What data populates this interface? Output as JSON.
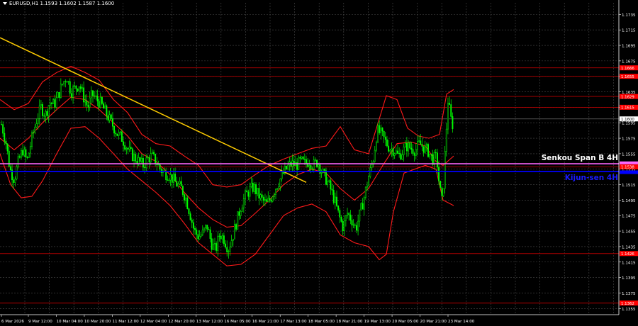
{
  "header": {
    "title": "EURUSD,H1  1.1593 1.1602 1.1587 1.1600"
  },
  "colors": {
    "background": "#000000",
    "grid": "#4a4a4a",
    "candle_up": "#00ff00",
    "candle_down": "#00ff00",
    "bands": "#ff1a1a",
    "level": "#b40000",
    "trendline": "#ffcc00",
    "senkou": "#ff66ff",
    "kijun": "#0000ff",
    "price_line": "#808080"
  },
  "chart_data": {
    "type": "candlestick",
    "symbol": "EURUSD",
    "timeframe": "H1",
    "ylim": [
      1.1347,
      1.175
    ],
    "grid": true,
    "y_ticks": [
      "1.1735",
      "1.1715",
      "1.1695",
      "1.1675",
      "1.1655",
      "1.1635",
      "1.1615",
      "1.1595",
      "1.1575",
      "1.1555",
      "1.1535",
      "1.1515",
      "1.1495",
      "1.1475",
      "1.1455",
      "1.1435",
      "1.1415",
      "1.1395",
      "1.1375",
      "1.1355"
    ],
    "x_ticks": [
      "6 Mar 2026",
      "9 Mar 12:00",
      "10 Mar 04:00",
      "10 Mar 20:00",
      "11 Mar 12:00",
      "12 Mar 04:00",
      "12 Mar 20:00",
      "13 Mar 12:00",
      "16 Mar 05:00",
      "16 Mar 21:00",
      "17 Mar 13:00",
      "18 Mar 05:00",
      "18 Mar 21:00",
      "19 Mar 13:00",
      "20 Mar 05:00",
      "20 Mar 21:00",
      "23 Mar 14:00"
    ],
    "levels": [
      {
        "label": "1.1666",
        "value": 1.1666
      },
      {
        "label": "1.1655",
        "value": 1.1655
      },
      {
        "label": "1.1629",
        "value": 1.1629
      },
      {
        "label": "1.1615",
        "value": 1.1615
      },
      {
        "label": "1.1538",
        "value": 1.1538
      },
      {
        "label": "1.1426",
        "value": 1.1426
      },
      {
        "label": "1.1362",
        "value": 1.1362
      }
    ],
    "indicator_lines": [
      {
        "name": "Senkou Span B 4H",
        "value": 1.1542,
        "label": "Senkou Span B 4H"
      },
      {
        "name": "Kijun-sen 4H",
        "value": 1.1532,
        "label": "Kijun-sen 4H"
      }
    ],
    "current_price": {
      "label": "1.1600",
      "value": 1.16
    },
    "trendline": {
      "from": {
        "x": 0,
        "y": 1.1705
      },
      "to": {
        "x": 432,
        "y": 1.1518
      }
    },
    "close_path": [
      [
        0,
        1.16
      ],
      [
        8,
        1.1572
      ],
      [
        14,
        1.1535
      ],
      [
        20,
        1.1522
      ],
      [
        26,
        1.1545
      ],
      [
        32,
        1.156
      ],
      [
        38,
        1.1545
      ],
      [
        45,
        1.1575
      ],
      [
        52,
        1.16
      ],
      [
        58,
        1.1615
      ],
      [
        64,
        1.1605
      ],
      [
        70,
        1.1622
      ],
      [
        76,
        1.1618
      ],
      [
        82,
        1.163
      ],
      [
        88,
        1.1645
      ],
      [
        94,
        1.1655
      ],
      [
        100,
        1.1635
      ],
      [
        106,
        1.164
      ],
      [
        112,
        1.1645
      ],
      [
        118,
        1.1628
      ],
      [
        124,
        1.1615
      ],
      [
        130,
        1.1632
      ],
      [
        136,
        1.1625
      ],
      [
        142,
        1.162
      ],
      [
        148,
        1.161
      ],
      [
        154,
        1.16
      ],
      [
        160,
        1.159
      ],
      [
        166,
        1.158
      ],
      [
        172,
        1.1575
      ],
      [
        178,
        1.1565
      ],
      [
        184,
        1.1555
      ],
      [
        190,
        1.155
      ],
      [
        196,
        1.1545
      ],
      [
        202,
        1.154
      ],
      [
        208,
        1.1548
      ],
      [
        214,
        1.1552
      ],
      [
        220,
        1.1545
      ],
      [
        226,
        1.1535
      ],
      [
        232,
        1.153
      ],
      [
        238,
        1.1528
      ],
      [
        244,
        1.1522
      ],
      [
        250,
        1.1515
      ],
      [
        256,
        1.151
      ],
      [
        262,
        1.1498
      ],
      [
        268,
        1.1478
      ],
      [
        274,
        1.1455
      ],
      [
        280,
        1.1448
      ],
      [
        286,
        1.1452
      ],
      [
        292,
        1.1462
      ],
      [
        298,
        1.144
      ],
      [
        304,
        1.143
      ],
      [
        310,
        1.1452
      ],
      [
        316,
        1.1445
      ],
      [
        322,
        1.1432
      ],
      [
        328,
        1.1448
      ],
      [
        334,
        1.1468
      ],
      [
        340,
        1.1488
      ],
      [
        346,
        1.15
      ],
      [
        352,
        1.1508
      ],
      [
        358,
        1.1512
      ],
      [
        364,
        1.1502
      ],
      [
        370,
        1.1495
      ],
      [
        376,
        1.149
      ],
      [
        382,
        1.1498
      ],
      [
        388,
        1.151
      ],
      [
        394,
        1.152
      ],
      [
        400,
        1.153
      ],
      [
        406,
        1.1538
      ],
      [
        412,
        1.1542
      ],
      [
        418,
        1.154
      ],
      [
        424,
        1.1545
      ],
      [
        430,
        1.1542
      ],
      [
        436,
        1.1546
      ],
      [
        442,
        1.154
      ],
      [
        448,
        1.1545
      ],
      [
        454,
        1.1532
      ],
      [
        460,
        1.1522
      ],
      [
        466,
        1.151
      ],
      [
        472,
        1.1495
      ],
      [
        478,
        1.1475
      ],
      [
        484,
        1.146
      ],
      [
        490,
        1.1478
      ],
      [
        496,
        1.147
      ],
      [
        502,
        1.1458
      ],
      [
        508,
        1.1478
      ],
      [
        514,
        1.15
      ],
      [
        520,
        1.1525
      ],
      [
        526,
        1.1545
      ],
      [
        532,
        1.1585
      ],
      [
        538,
        1.158
      ],
      [
        544,
        1.157
      ],
      [
        550,
        1.1562
      ],
      [
        556,
        1.156
      ],
      [
        562,
        1.1552
      ],
      [
        568,
        1.1558
      ],
      [
        574,
        1.1565
      ],
      [
        580,
        1.1562
      ],
      [
        586,
        1.156
      ],
      [
        592,
        1.1568
      ],
      [
        598,
        1.1563
      ],
      [
        604,
        1.1558
      ],
      [
        610,
        1.1548
      ],
      [
        616,
        1.155
      ],
      [
        620,
        1.1512
      ],
      [
        624,
        1.149
      ],
      [
        628,
        1.156
      ],
      [
        632,
        1.1625
      ],
      [
        636,
        1.16
      ],
      [
        640,
        1.1588
      ]
    ],
    "upper_band": [
      [
        0,
        1.1625
      ],
      [
        20,
        1.1612
      ],
      [
        40,
        1.162
      ],
      [
        60,
        1.1648
      ],
      [
        80,
        1.166
      ],
      [
        100,
        1.1668
      ],
      [
        120,
        1.166
      ],
      [
        140,
        1.165
      ],
      [
        160,
        1.1625
      ],
      [
        180,
        1.1608
      ],
      [
        200,
        1.158
      ],
      [
        220,
        1.1568
      ],
      [
        240,
        1.1565
      ],
      [
        260,
        1.1552
      ],
      [
        280,
        1.154
      ],
      [
        300,
        1.1515
      ],
      [
        320,
        1.1512
      ],
      [
        340,
        1.1515
      ],
      [
        360,
        1.1528
      ],
      [
        380,
        1.154
      ],
      [
        400,
        1.1548
      ],
      [
        420,
        1.1555
      ],
      [
        440,
        1.1562
      ],
      [
        460,
        1.1565
      ],
      [
        480,
        1.159
      ],
      [
        500,
        1.156
      ],
      [
        520,
        1.1555
      ],
      [
        535,
        1.16
      ],
      [
        545,
        1.163
      ],
      [
        560,
        1.1625
      ],
      [
        575,
        1.1588
      ],
      [
        590,
        1.1578
      ],
      [
        605,
        1.1575
      ],
      [
        620,
        1.158
      ],
      [
        630,
        1.1632
      ],
      [
        640,
        1.1638
      ]
    ],
    "middle_band": [
      [
        0,
        1.1575
      ],
      [
        20,
        1.156
      ],
      [
        40,
        1.1575
      ],
      [
        60,
        1.1595
      ],
      [
        80,
        1.1612
      ],
      [
        100,
        1.1628
      ],
      [
        120,
        1.1625
      ],
      [
        140,
        1.1612
      ],
      [
        160,
        1.1595
      ],
      [
        180,
        1.1578
      ],
      [
        200,
        1.1555
      ],
      [
        220,
        1.1545
      ],
      [
        240,
        1.1528
      ],
      [
        260,
        1.1505
      ],
      [
        280,
        1.1485
      ],
      [
        300,
        1.147
      ],
      [
        320,
        1.146
      ],
      [
        340,
        1.1462
      ],
      [
        360,
        1.1478
      ],
      [
        380,
        1.1495
      ],
      [
        400,
        1.1515
      ],
      [
        420,
        1.1528
      ],
      [
        440,
        1.1535
      ],
      [
        460,
        1.153
      ],
      [
        480,
        1.151
      ],
      [
        500,
        1.1495
      ],
      [
        520,
        1.151
      ],
      [
        540,
        1.154
      ],
      [
        560,
        1.1568
      ],
      [
        580,
        1.157
      ],
      [
        600,
        1.1565
      ],
      [
        615,
        1.1545
      ],
      [
        625,
        1.154
      ],
      [
        640,
        1.1552
      ]
    ],
    "lower_band": [
      [
        0,
        1.1555
      ],
      [
        15,
        1.1515
      ],
      [
        30,
        1.1498
      ],
      [
        45,
        1.15
      ],
      [
        60,
        1.152
      ],
      [
        80,
        1.1555
      ],
      [
        100,
        1.1588
      ],
      [
        120,
        1.159
      ],
      [
        140,
        1.1575
      ],
      [
        160,
        1.1555
      ],
      [
        180,
        1.1535
      ],
      [
        200,
        1.152
      ],
      [
        220,
        1.1505
      ],
      [
        240,
        1.1488
      ],
      [
        260,
        1.1465
      ],
      [
        280,
        1.144
      ],
      [
        300,
        1.1425
      ],
      [
        320,
        1.141
      ],
      [
        340,
        1.1412
      ],
      [
        360,
        1.1425
      ],
      [
        380,
        1.145
      ],
      [
        400,
        1.1475
      ],
      [
        420,
        1.1485
      ],
      [
        440,
        1.149
      ],
      [
        460,
        1.148
      ],
      [
        480,
        1.145
      ],
      [
        500,
        1.144
      ],
      [
        520,
        1.1435
      ],
      [
        535,
        1.1418
      ],
      [
        545,
        1.1425
      ],
      [
        555,
        1.148
      ],
      [
        570,
        1.153
      ],
      [
        585,
        1.1535
      ],
      [
        600,
        1.154
      ],
      [
        615,
        1.1535
      ],
      [
        625,
        1.1495
      ],
      [
        640,
        1.1488
      ]
    ]
  }
}
